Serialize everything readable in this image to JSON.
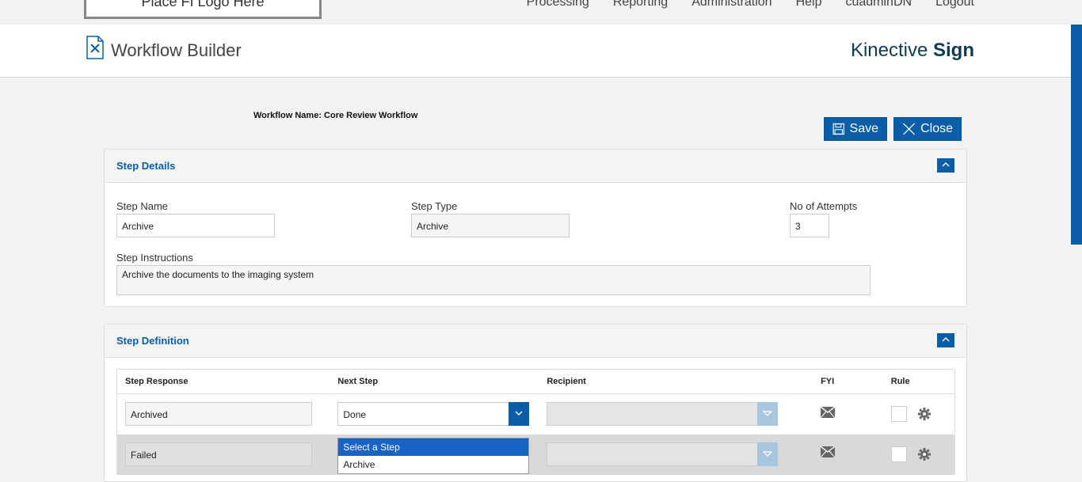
{
  "topnav": {
    "logo": "Place FI Logo Here",
    "links": [
      "Processing",
      "Reporting",
      "Administration",
      "Help",
      "cuadminDN",
      "Logout"
    ]
  },
  "header": {
    "title": "Workflow Builder",
    "brand_light": "Kinective",
    "brand_bold": "Sign"
  },
  "workflow": {
    "name_label": "Workflow Name: Core Review Workflow"
  },
  "toolbar": {
    "save_label": "Save",
    "close_label": "Close"
  },
  "step_details": {
    "title": "Step Details",
    "step_name_label": "Step Name",
    "step_name_value": "Archive",
    "step_type_label": "Step Type",
    "step_type_value": "Archive",
    "attempts_label": "No of Attempts",
    "attempts_value": "3",
    "instructions_label": "Step Instructions",
    "instructions_value": "Archive the documents to the imaging system"
  },
  "step_definition": {
    "title": "Step Definition",
    "columns": [
      "Step Response",
      "Next Step",
      "Recipient",
      "FYI",
      "Rule"
    ],
    "rows": [
      {
        "response": "Archived",
        "next_step": "Done"
      },
      {
        "response": "Failed",
        "next_step": ""
      }
    ],
    "dropdown_options": [
      "Select a Step",
      "Archive"
    ]
  },
  "colors": {
    "accent": "#0a5ea8",
    "highlight": "#1a63c4"
  }
}
